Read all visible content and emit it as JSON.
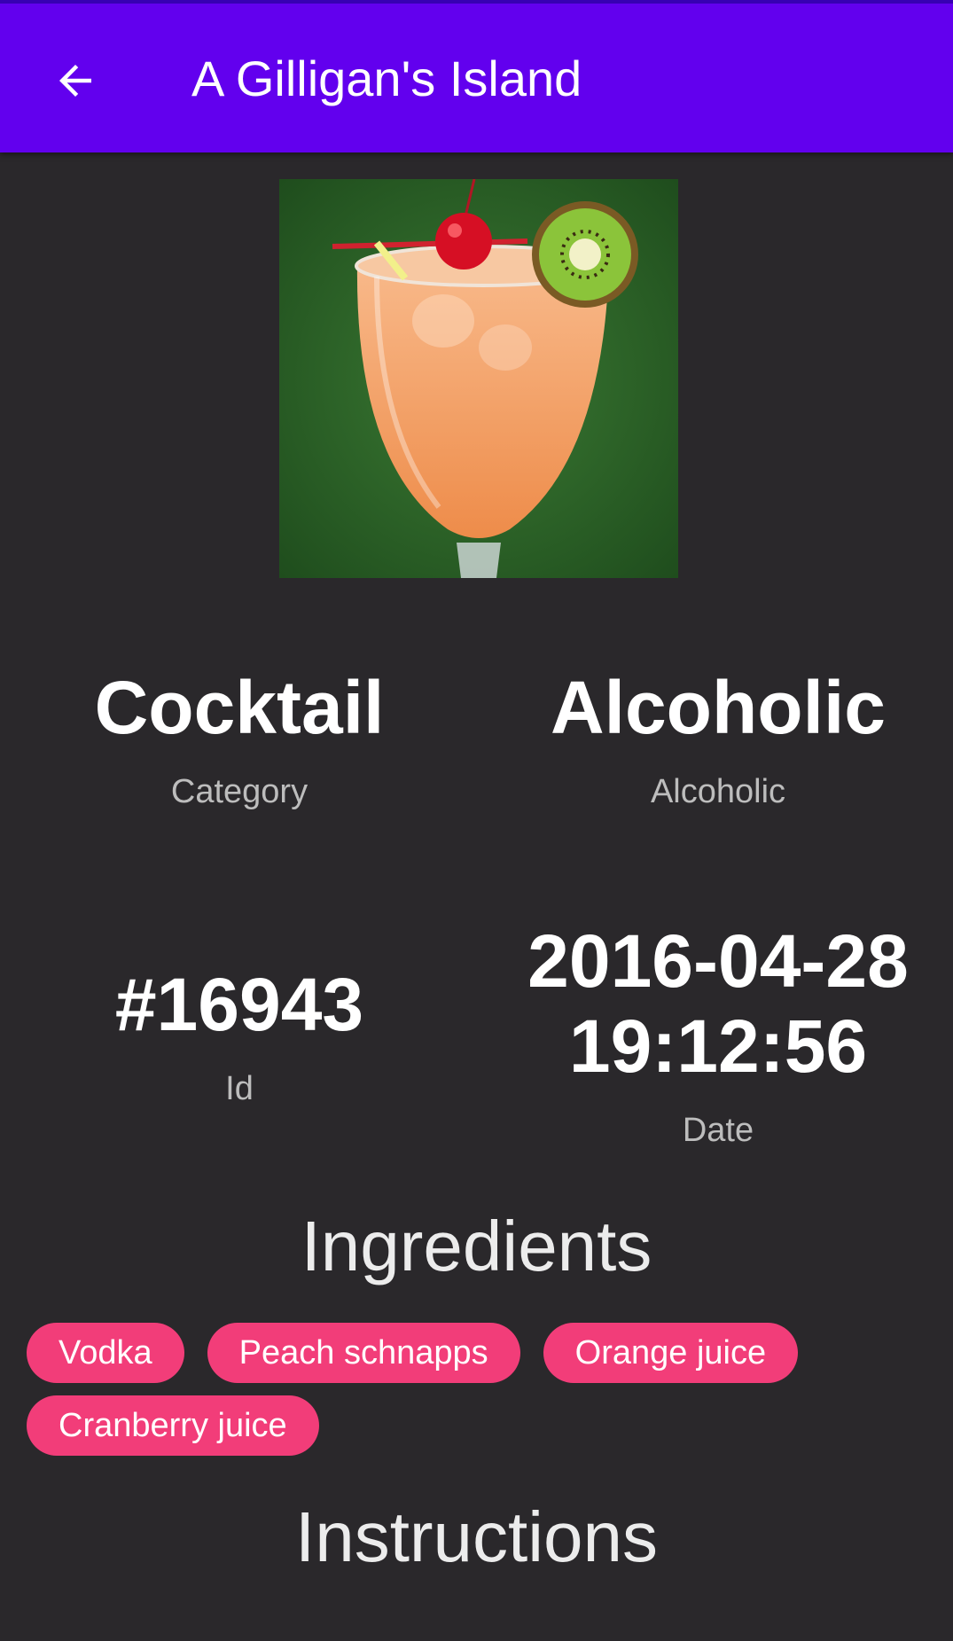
{
  "header": {
    "title": "A Gilligan's Island",
    "back_icon": "arrow-left-icon"
  },
  "photo": {
    "subject": "cocktail-glass-image",
    "colors": {
      "background": "#2f6a2a",
      "drink": "#f4a46c",
      "cherry": "#d60f24",
      "kiwi": "#8bc43a"
    }
  },
  "stats": {
    "category": {
      "value": "Cocktail",
      "label": "Category"
    },
    "alcoholic": {
      "value": "Alcoholic",
      "label": "Alcoholic"
    },
    "id": {
      "value": "#16943",
      "label": "Id"
    },
    "date": {
      "value_line1": "2016-04-28",
      "value_line2": "19:12:56",
      "label": "Date"
    }
  },
  "ingredients": {
    "title": "Ingredients",
    "items": [
      "Vodka",
      "Peach schnapps",
      "Orange juice",
      "Cranberry juice"
    ]
  },
  "instructions": {
    "title": "Instructions"
  },
  "colors": {
    "appbar": "#6200ee",
    "background": "#2a282b",
    "chip": "#f23d79"
  }
}
